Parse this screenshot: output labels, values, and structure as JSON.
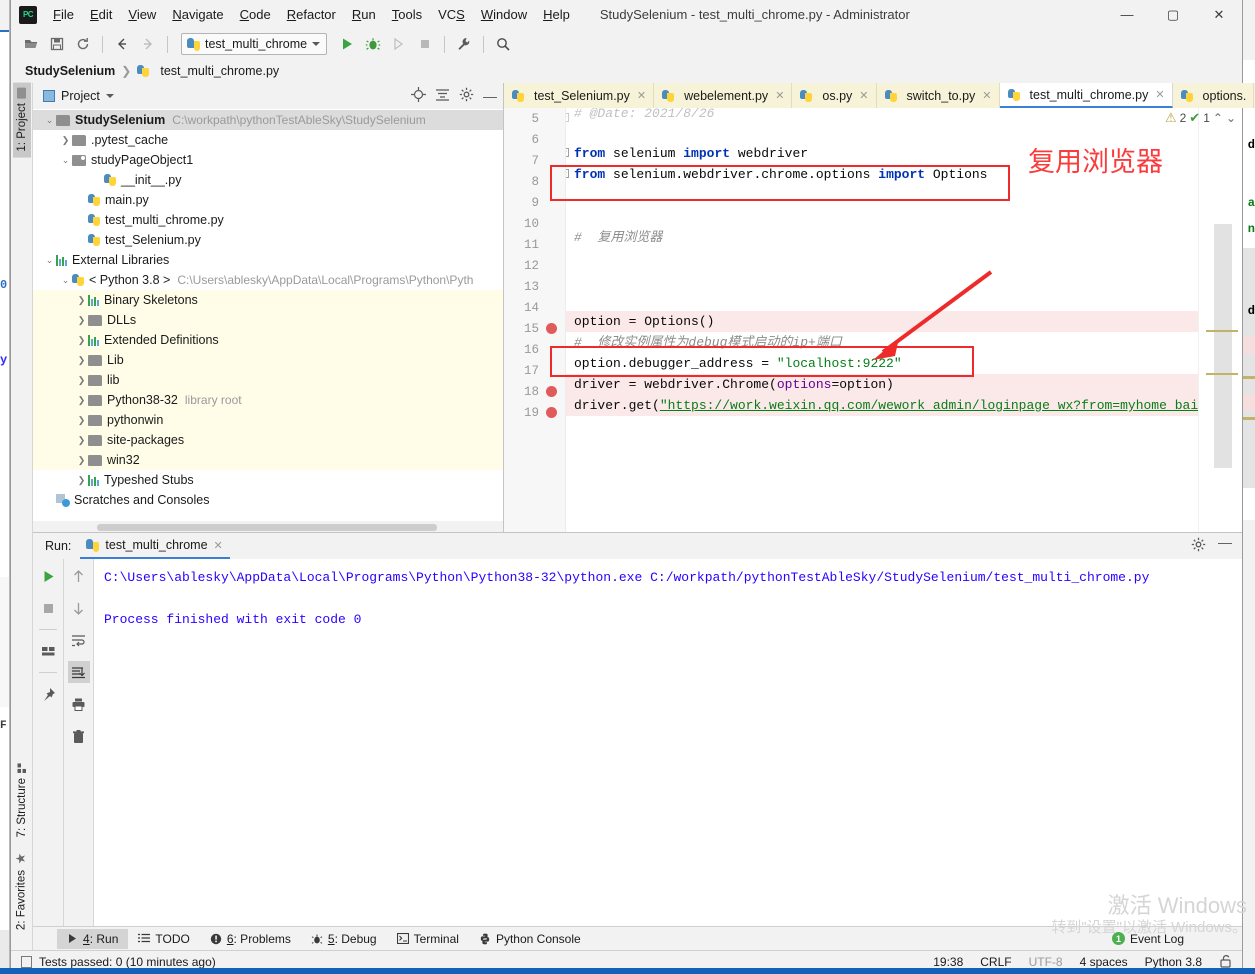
{
  "window": {
    "title": "StudySelenium - test_multi_chrome.py - Administrator",
    "minimize": "—",
    "maximize": "▢",
    "close": "✕",
    "logo_text": "PC"
  },
  "menubar": {
    "items": [
      "File",
      "Edit",
      "View",
      "Navigate",
      "Code",
      "Refactor",
      "Run",
      "Tools",
      "VCS",
      "Window",
      "Help"
    ]
  },
  "toolbar": {
    "open_icon": "open-folder-icon",
    "save_icon": "save-icon",
    "sync_icon": "refresh-icon",
    "back_icon": "back-arrow-icon",
    "forward_icon": "forward-arrow-icon",
    "run_config": "test_multi_chrome",
    "run_icon": "run-icon",
    "debug_icon": "debug-icon",
    "coverage_icon": "run-with-coverage-icon",
    "stop_icon": "stop-icon",
    "settings_icon": "wrench-icon",
    "search_icon": "search-icon"
  },
  "breadcrumb": {
    "project": "StudySelenium",
    "separator": "❯",
    "file": "test_multi_chrome.py"
  },
  "left_tool_window": {
    "project_tab": "1: Project",
    "structure_tab": "7: Structure",
    "favorites_tab": "2: Favorites"
  },
  "project_panel": {
    "title": "Project",
    "action_icons": [
      "locate-icon",
      "collapse-all-icon",
      "gear-icon",
      "hide-icon"
    ],
    "tree": [
      {
        "indent": 0,
        "arrow": "v",
        "icon": "folder",
        "label": "StudySelenium",
        "bold": true,
        "path": "C:\\workpath\\pythonTestAbleSky\\StudySelenium",
        "selected": true,
        "lib": false
      },
      {
        "indent": 1,
        "arrow": ">",
        "icon": "folder",
        "label": ".pytest_cache",
        "bold": false,
        "path": "",
        "selected": false,
        "lib": false
      },
      {
        "indent": 1,
        "arrow": "v",
        "icon": "folder-src",
        "label": "studyPageObject1",
        "bold": false,
        "path": "",
        "selected": false,
        "lib": false
      },
      {
        "indent": 3,
        "arrow": "",
        "icon": "python",
        "label": "__init__.py",
        "bold": false,
        "path": "",
        "selected": false,
        "lib": false
      },
      {
        "indent": 2,
        "arrow": "",
        "icon": "python",
        "label": "main.py",
        "bold": false,
        "path": "",
        "selected": false,
        "lib": false
      },
      {
        "indent": 2,
        "arrow": "",
        "icon": "python",
        "label": "test_multi_chrome.py",
        "bold": false,
        "path": "",
        "selected": false,
        "lib": false
      },
      {
        "indent": 2,
        "arrow": "",
        "icon": "python",
        "label": "test_Selenium.py",
        "bold": false,
        "path": "",
        "selected": false,
        "lib": false
      },
      {
        "indent": 0,
        "arrow": "v",
        "icon": "bars",
        "label": "External Libraries",
        "bold": false,
        "path": "",
        "selected": false,
        "lib": false
      },
      {
        "indent": 1,
        "arrow": "v",
        "icon": "python",
        "label": "< Python 3.8 >",
        "bold": false,
        "path": "C:\\Users\\ablesky\\AppData\\Local\\Programs\\Python\\Pyth",
        "selected": false,
        "lib": false
      },
      {
        "indent": 2,
        "arrow": ">",
        "icon": "bars",
        "label": "Binary Skeletons",
        "bold": false,
        "path": "",
        "selected": false,
        "lib": true
      },
      {
        "indent": 2,
        "arrow": ">",
        "icon": "folder",
        "label": "DLLs",
        "bold": false,
        "path": "",
        "selected": false,
        "lib": true
      },
      {
        "indent": 2,
        "arrow": ">",
        "icon": "bars",
        "label": "Extended Definitions",
        "bold": false,
        "path": "",
        "selected": false,
        "lib": true
      },
      {
        "indent": 2,
        "arrow": ">",
        "icon": "folder",
        "label": "Lib",
        "bold": false,
        "path": "",
        "selected": false,
        "lib": true
      },
      {
        "indent": 2,
        "arrow": ">",
        "icon": "folder",
        "label": "lib",
        "bold": false,
        "path": "",
        "selected": false,
        "lib": true
      },
      {
        "indent": 2,
        "arrow": ">",
        "icon": "folder",
        "label": "Python38-32",
        "bold": false,
        "path": "library root",
        "selected": false,
        "lib": true
      },
      {
        "indent": 2,
        "arrow": ">",
        "icon": "folder",
        "label": "pythonwin",
        "bold": false,
        "path": "",
        "selected": false,
        "lib": true
      },
      {
        "indent": 2,
        "arrow": ">",
        "icon": "folder",
        "label": "site-packages",
        "bold": false,
        "path": "",
        "selected": false,
        "lib": true
      },
      {
        "indent": 2,
        "arrow": ">",
        "icon": "folder",
        "label": "win32",
        "bold": false,
        "path": "",
        "selected": false,
        "lib": true
      },
      {
        "indent": 2,
        "arrow": ">",
        "icon": "bars",
        "label": "Typeshed Stubs",
        "bold": false,
        "path": "",
        "selected": false,
        "lib": false
      },
      {
        "indent": 0,
        "arrow": "",
        "icon": "scratch",
        "label": "Scratches and Consoles",
        "bold": false,
        "path": "",
        "selected": false,
        "lib": false
      }
    ]
  },
  "editor": {
    "tabs": [
      {
        "label": "test_Selenium.py",
        "active": false,
        "close": "✕"
      },
      {
        "label": "webelement.py",
        "active": false,
        "close": "✕"
      },
      {
        "label": "os.py",
        "active": false,
        "close": "✕"
      },
      {
        "label": "switch_to.py",
        "active": false,
        "close": "✕"
      },
      {
        "label": "test_multi_chrome.py",
        "active": true,
        "close": "✕"
      },
      {
        "label": "options.",
        "active": false,
        "close": ""
      }
    ],
    "tab_overflow_icon": "chevron-down-icon",
    "inspections": {
      "warning_count": "2",
      "ok_count": "1",
      "up": "⌃",
      "down": "⌄"
    },
    "line_numbers": [
      "5",
      "6",
      "7",
      "8",
      "9",
      "10",
      "11",
      "12",
      "13",
      "14",
      "15",
      "16",
      "17",
      "18",
      "19"
    ],
    "breakpoint_lines": [
      "15",
      "18",
      "19"
    ],
    "lines": [
      {
        "num": "5",
        "fold": "−",
        "highlight": false,
        "partial": true,
        "tokens": [
          {
            "t": "# @Date: 2021/8/26",
            "c": "cmt"
          }
        ]
      },
      {
        "num": "6",
        "fold": "",
        "highlight": false,
        "tokens": []
      },
      {
        "num": "7",
        "fold": "−",
        "highlight": false,
        "tokens": [
          {
            "t": "from",
            "c": "kw"
          },
          {
            "t": " selenium ",
            "c": "plain"
          },
          {
            "t": "import",
            "c": "kw"
          },
          {
            "t": " webdriver",
            "c": "plain"
          }
        ]
      },
      {
        "num": "8",
        "fold": "−",
        "highlight": false,
        "tokens": [
          {
            "t": "from",
            "c": "kw"
          },
          {
            "t": " selenium.webdriver.chrome.options ",
            "c": "plain"
          },
          {
            "t": "import",
            "c": "kw"
          },
          {
            "t": " Options",
            "c": "plain"
          }
        ]
      },
      {
        "num": "9",
        "fold": "",
        "highlight": false,
        "tokens": []
      },
      {
        "num": "10",
        "fold": "",
        "highlight": false,
        "tokens": []
      },
      {
        "num": "11",
        "fold": "",
        "highlight": false,
        "tokens": [
          {
            "t": "#  复用浏览器",
            "c": "cmt"
          }
        ]
      },
      {
        "num": "12",
        "fold": "",
        "highlight": false,
        "tokens": []
      },
      {
        "num": "13",
        "fold": "",
        "highlight": false,
        "tokens": []
      },
      {
        "num": "14",
        "fold": "",
        "highlight": false,
        "tokens": []
      },
      {
        "num": "15",
        "fold": "",
        "highlight": true,
        "tokens": [
          {
            "t": "option = Options()",
            "c": "plain"
          }
        ]
      },
      {
        "num": "16",
        "fold": "",
        "highlight": false,
        "tokens": [
          {
            "t": "#  修改实例属性为debug模式启动的ip+端口",
            "c": "cmt"
          }
        ]
      },
      {
        "num": "17",
        "fold": "",
        "highlight": false,
        "tokens": [
          {
            "t": "option.debugger_address = ",
            "c": "plain"
          },
          {
            "t": "\"localhost:9222\"",
            "c": "str"
          }
        ]
      },
      {
        "num": "18",
        "fold": "",
        "highlight": true,
        "tokens": [
          {
            "t": "driver = webdriver.Chrome(",
            "c": "plain"
          },
          {
            "t": "options",
            "c": "named"
          },
          {
            "t": "=option)",
            "c": "plain"
          }
        ]
      },
      {
        "num": "19",
        "fold": "",
        "highlight": true,
        "tokens": [
          {
            "t": "driver.get(",
            "c": "plain"
          },
          {
            "t": "\"https://work.weixin.qq.com/wework_admin/loginpage_wx?from=myhome_baidu\"",
            "c": "urlstr"
          },
          {
            "t": ")",
            "c": "plain"
          }
        ]
      }
    ]
  },
  "annotations": {
    "red_text": "复用浏览器",
    "box_1_target": "import-options-line",
    "box_2_target": "debugger-address-line",
    "arrow_target": "debugger-address-line"
  },
  "run_panel": {
    "label": "Run:",
    "tab_name": "test_multi_chrome",
    "tab_close": "✕",
    "header_icons": [
      "gear-icon",
      "hide-icon"
    ],
    "left_tools": [
      "rerun-icon",
      "stop-icon",
      "restore-layout-icon",
      "pin-icon"
    ],
    "right_tools": [
      "up-arrow-icon",
      "down-arrow-icon",
      "soft-wrap-icon",
      "scroll-to-end-icon",
      "print-icon",
      "trash-icon"
    ],
    "output_lines": [
      "C:\\Users\\ablesky\\AppData\\Local\\Programs\\Python\\Python38-32\\python.exe C:/workpath/pythonTestAbleSky/StudySelenium/test_multi_chrome.py",
      "",
      "Process finished with exit code 0"
    ]
  },
  "bottom_bar": {
    "items": [
      {
        "label": "4: Run",
        "icon": "run-icon",
        "selected": true,
        "mnemonic": "4"
      },
      {
        "label": "TODO",
        "icon": "todo-icon",
        "selected": false,
        "mnemonic": ""
      },
      {
        "label": "6: Problems",
        "icon": "problems-icon",
        "selected": false,
        "mnemonic": "6"
      },
      {
        "label": "5: Debug",
        "icon": "debug-icon",
        "selected": false,
        "mnemonic": "5"
      },
      {
        "label": "Terminal",
        "icon": "terminal-icon",
        "selected": false,
        "mnemonic": ""
      },
      {
        "label": "Python Console",
        "icon": "python-icon",
        "selected": false,
        "mnemonic": ""
      }
    ],
    "event_log": "Event Log",
    "event_log_count": "1"
  },
  "status_bar": {
    "message": "Tests passed: 0 (10 minutes ago)",
    "time": "19:38",
    "line_separator": "CRLF",
    "encoding": "UTF-8",
    "indent": "4 spaces",
    "interpreter": "Python 3.8",
    "lock_icon": "unlock-icon"
  },
  "watermark": {
    "line1": "激活 Windows",
    "line2": "转到\"设置\"以激活 Windows。"
  },
  "colors": {
    "accent_blue": "#3b7fd4",
    "annotation_red": "#ee2a2a",
    "library_yellow": "#fffce8",
    "highlight_pink": "#fbe9e9",
    "keyword_blue": "#0033b3",
    "string_green": "#067d17",
    "comment_gray": "#8c8c8c",
    "console_blue": "#2a00ff",
    "taskbar_blue": "#1361b8"
  }
}
